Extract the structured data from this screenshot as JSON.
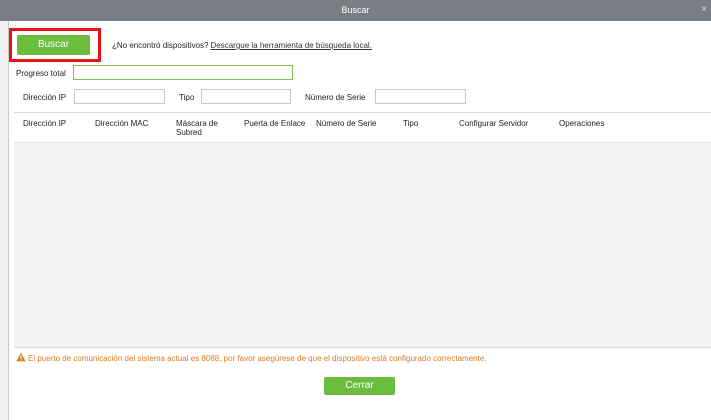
{
  "window": {
    "title": "Buscar",
    "close_symbol": "×"
  },
  "search": {
    "button_label": "Buscar",
    "not_found_text": "¿No encontró dispositivos?",
    "download_link": "Descargue la herramienta de búsqueda local."
  },
  "progress": {
    "label": "Progreso total",
    "value": ""
  },
  "filters": {
    "ip_label": "Dirección IP",
    "ip_value": "",
    "type_label": "Tipo",
    "type_value": "",
    "serial_label": "Número de Serie",
    "serial_value": ""
  },
  "table": {
    "columns": [
      "Dirección IP",
      "Dirección MAC",
      "Máscara de Subred",
      "Puerta de Enlace",
      "Número de Serie",
      "Tipo",
      "Configurar Servidor",
      "Operaciones"
    ],
    "rows": []
  },
  "warning": {
    "text": "El puerto de comunicación del sistema actual es 8088, por favor asegúrese de que el dispositivo está configurado correctamente.",
    "icon": "warning-triangle-icon",
    "color": "#e07a1f"
  },
  "footer": {
    "close_label": "Cerrar"
  },
  "colors": {
    "accent": "#6cbd3d",
    "highlight": "#e8121b",
    "titlebar": "#797d84"
  }
}
